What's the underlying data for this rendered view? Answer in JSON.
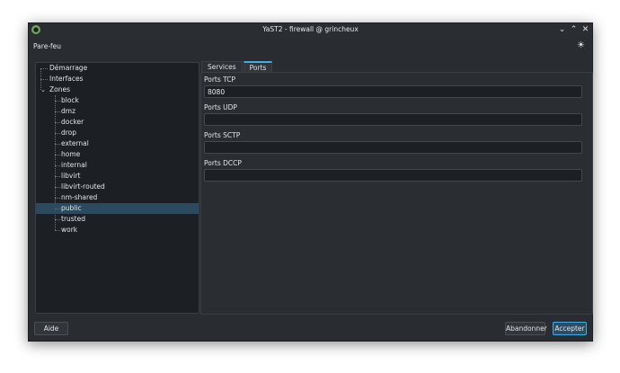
{
  "window": {
    "title": "YaST2 - firewall @ grincheux"
  },
  "module": {
    "title": "Pare-feu"
  },
  "tree": {
    "items": [
      {
        "label": "Démarrage"
      },
      {
        "label": "Interfaces"
      },
      {
        "label": "Zones",
        "expanded": true,
        "children": [
          {
            "label": "block"
          },
          {
            "label": "dmz"
          },
          {
            "label": "docker"
          },
          {
            "label": "drop"
          },
          {
            "label": "external"
          },
          {
            "label": "home"
          },
          {
            "label": "internal"
          },
          {
            "label": "libvirt"
          },
          {
            "label": "libvirt-routed"
          },
          {
            "label": "nm-shared"
          },
          {
            "label": "public",
            "selected": true
          },
          {
            "label": "trusted"
          },
          {
            "label": "work"
          }
        ]
      }
    ]
  },
  "tabs": [
    {
      "label": "Services",
      "active": false
    },
    {
      "label": "Ports",
      "active": true
    }
  ],
  "ports": {
    "tcp_label": "Ports TCP",
    "tcp_value": "8080",
    "udp_label": "Ports UDP",
    "udp_value": "",
    "sctp_label": "Ports SCTP",
    "sctp_value": "",
    "dccp_label": "Ports DCCP",
    "dccp_value": ""
  },
  "buttons": {
    "help": "Aide",
    "cancel": "Abandonner",
    "accept": "Accepter"
  },
  "colors": {
    "accent": "#3daee9",
    "selection": "#2c4a5f",
    "window_bg": "#292c30"
  },
  "icons": {
    "app": "yast-icon",
    "theme": "sun-icon"
  }
}
